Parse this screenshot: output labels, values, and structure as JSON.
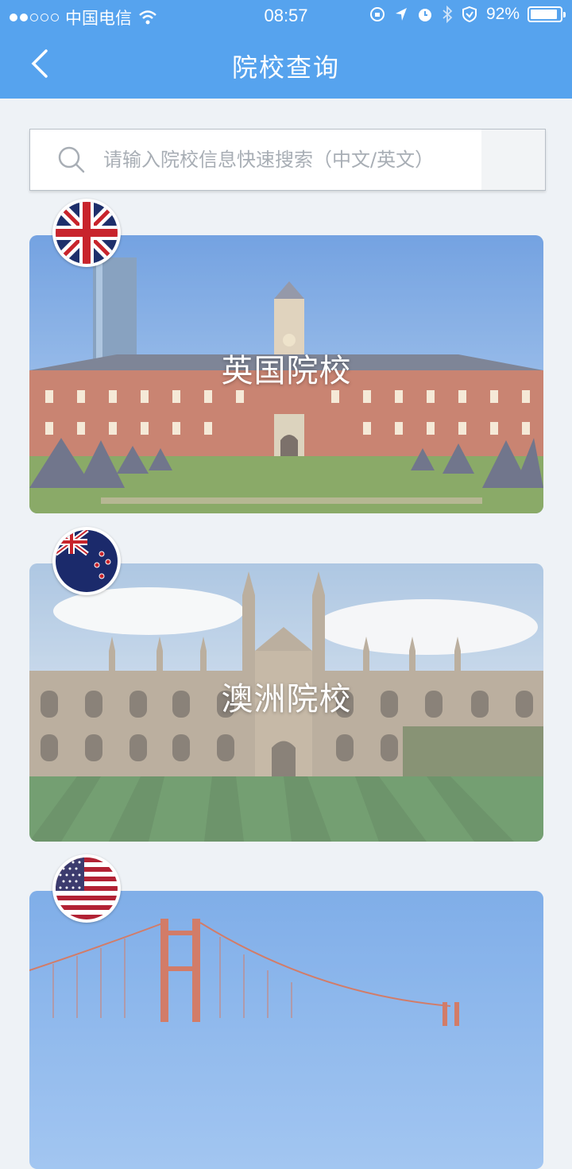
{
  "status_bar": {
    "carrier": "中国电信",
    "time": "08:57",
    "battery": "92%",
    "battery_level": 0.92,
    "signal_bars_filled": 2,
    "signal_bars_total": 5
  },
  "nav": {
    "title": "院校查询",
    "back_icon": "chevron-left-icon"
  },
  "search": {
    "placeholder": "请输入院校信息快速搜索（中文/英文）",
    "value": "",
    "icon": "search-icon"
  },
  "cards": [
    {
      "label": "英国院校",
      "flag": "uk-flag-icon"
    },
    {
      "label": "澳洲院校",
      "flag": "nz-flag-icon"
    },
    {
      "label": "",
      "flag": "us-flag-icon"
    }
  ],
  "colors": {
    "primary": "#56a3ee",
    "background": "#eef2f6"
  }
}
